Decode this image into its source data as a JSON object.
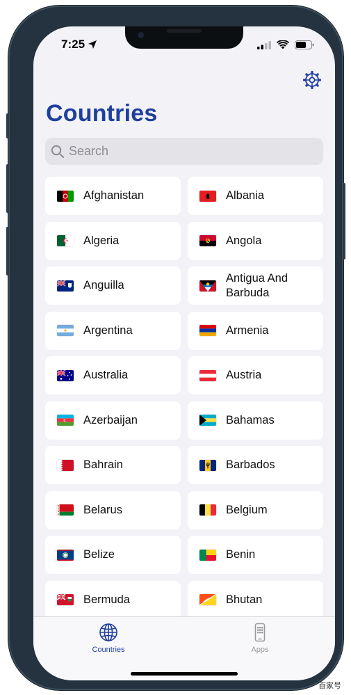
{
  "status": {
    "time": "7:25"
  },
  "header": {
    "title": "Countries"
  },
  "search": {
    "placeholder": "Search"
  },
  "countries": [
    {
      "name": "Afghanistan",
      "flag": "flag-afghanistan"
    },
    {
      "name": "Albania",
      "flag": "flag-albania"
    },
    {
      "name": "Algeria",
      "flag": "flag-algeria"
    },
    {
      "name": "Angola",
      "flag": "flag-angola"
    },
    {
      "name": "Anguilla",
      "flag": "flag-anguilla"
    },
    {
      "name": "Antigua And Barbuda",
      "flag": "flag-antigua-and-barbuda"
    },
    {
      "name": "Argentina",
      "flag": "flag-argentina"
    },
    {
      "name": "Armenia",
      "flag": "flag-armenia"
    },
    {
      "name": "Australia",
      "flag": "flag-australia"
    },
    {
      "name": "Austria",
      "flag": "flag-austria"
    },
    {
      "name": "Azerbaijan",
      "flag": "flag-azerbaijan"
    },
    {
      "name": "Bahamas",
      "flag": "flag-bahamas"
    },
    {
      "name": "Bahrain",
      "flag": "flag-bahrain"
    },
    {
      "name": "Barbados",
      "flag": "flag-barbados"
    },
    {
      "name": "Belarus",
      "flag": "flag-belarus"
    },
    {
      "name": "Belgium",
      "flag": "flag-belgium"
    },
    {
      "name": "Belize",
      "flag": "flag-belize"
    },
    {
      "name": "Benin",
      "flag": "flag-benin"
    },
    {
      "name": "Bermuda",
      "flag": "flag-bermuda"
    },
    {
      "name": "Bhutan",
      "flag": "flag-bhutan"
    }
  ],
  "tabs": [
    {
      "label": "Countries",
      "icon": "globe-icon",
      "active": true
    },
    {
      "label": "Apps",
      "icon": "phone-icon",
      "active": false
    }
  ],
  "watermark": "百家号",
  "colors": {
    "accent": "#1f3f9d",
    "tab_active": "#1f3f9d",
    "tab_inactive": "#9a9a9e"
  }
}
